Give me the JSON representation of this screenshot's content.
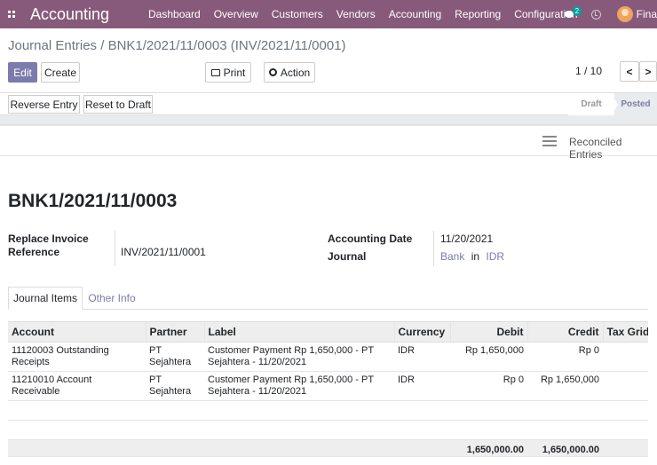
{
  "navbar": {
    "app_title": "Accounting",
    "menu": [
      "Dashboard",
      "Overview",
      "Customers",
      "Vendors",
      "Accounting",
      "Reporting",
      "Configuration"
    ],
    "chat_count": "2",
    "user_name": "Fina"
  },
  "breadcrumb": {
    "parent": "Journal Entries",
    "separator": "/",
    "current": "BNK1/2021/11/0003 (INV/2021/11/0001)"
  },
  "control": {
    "edit_label": "Edit",
    "create_label": "Create",
    "print_label": "Print",
    "action_label": "Action",
    "pager": "1 / 10",
    "prev_glyph": "<",
    "next_glyph": ">"
  },
  "statusbar": {
    "reverse_label": "Reverse Entry",
    "reset_label": "Reset to Draft",
    "stages": [
      "Draft",
      "Posted"
    ],
    "active_stage": "Posted"
  },
  "sheet": {
    "reconciled_label": "Reconciled Entries",
    "record_name": "BNK1/2021/11/0003",
    "fields": {
      "ref_label_1": "Replace Invoice",
      "ref_label_2": "Reference",
      "ref_value": "INV/2021/11/0001",
      "date_label": "Accounting Date",
      "date_value": "11/20/2021",
      "journal_label": "Journal",
      "journal_value": "Bank",
      "journal_in": "in",
      "journal_currency": "IDR"
    }
  },
  "tabs": [
    "Journal Items",
    "Other Info"
  ],
  "table": {
    "columns": [
      "Account",
      "Partner",
      "Label",
      "Currency",
      "Debit",
      "Credit",
      "Tax Grids"
    ],
    "rows": [
      {
        "account": "11120003 Outstanding Receipts",
        "partner": "PT Sejahtera",
        "label": "Customer Payment Rp 1,650,000 - PT Sejahtera - 11/20/2021",
        "currency": "IDR",
        "debit": "Rp 1,650,000",
        "credit": "Rp 0",
        "tax_grids": ""
      },
      {
        "account": "11210010 Account Receivable",
        "partner": "PT Sejahtera",
        "label": "Customer Payment Rp 1,650,000 - PT Sejahtera - 11/20/2021",
        "currency": "IDR",
        "debit": "Rp 0",
        "credit": "Rp 1,650,000",
        "tax_grids": ""
      }
    ],
    "total_debit": "1,650,000.00",
    "total_credit": "1,650,000.00"
  },
  "colors": {
    "navbar": "#875a7b",
    "primary": "#7c7bad"
  }
}
